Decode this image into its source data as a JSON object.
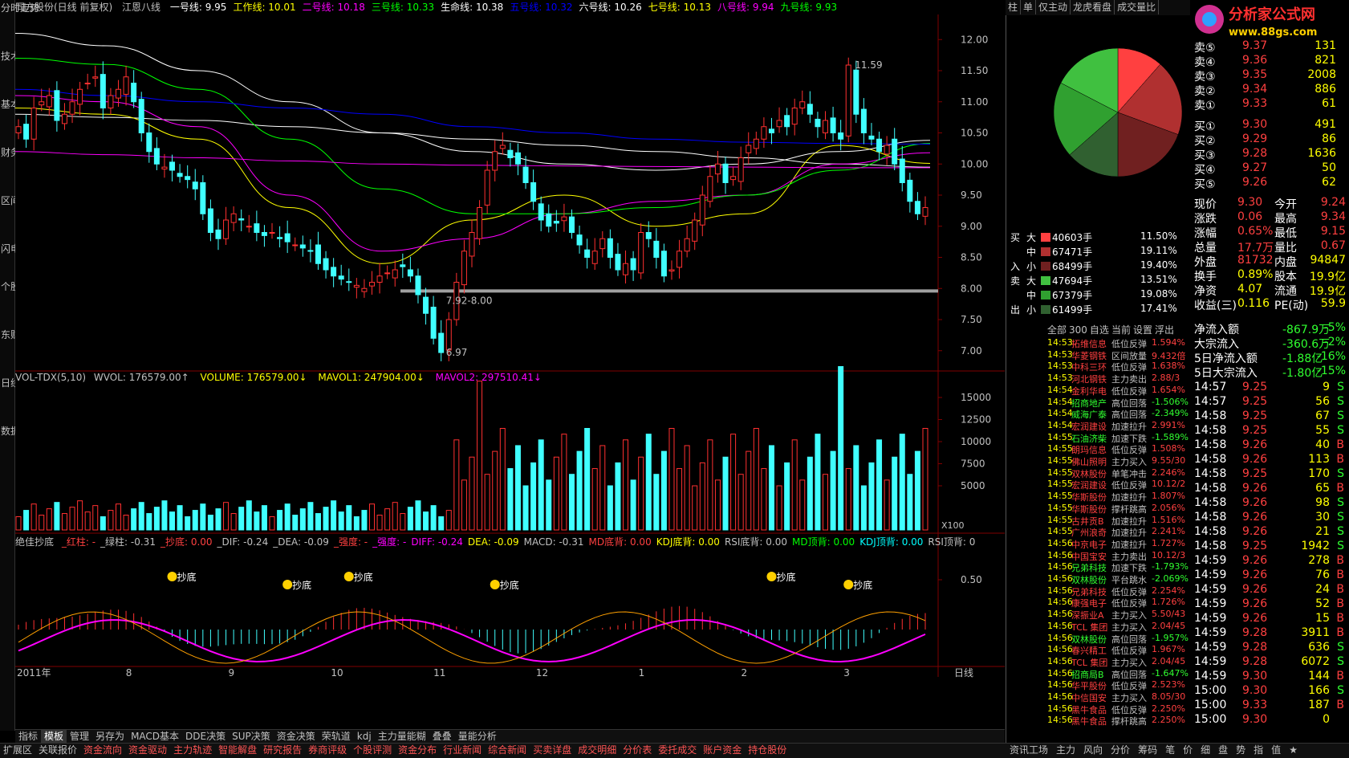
{
  "app_title": "同方股份(日线 前复权)",
  "header": {
    "indicator": "江恩八线",
    "lines": [
      {
        "label": "一号线: 9.95",
        "color": "#ffffff"
      },
      {
        "label": "工作线: 10.01",
        "color": "#ffff00"
      },
      {
        "label": "二号线: 10.18",
        "color": "#ff00ff"
      },
      {
        "label": "三号线: 10.33",
        "color": "#00ff00"
      },
      {
        "label": "生命线: 10.38",
        "color": "#ffffff"
      },
      {
        "label": "五号线: 10.32",
        "color": "#0000ff"
      },
      {
        "label": "六号线: 10.26",
        "color": "#ffffff"
      },
      {
        "label": "七号线: 10.13",
        "color": "#ffff00"
      },
      {
        "label": "八号线: 9.94",
        "color": "#ff00ff"
      },
      {
        "label": "九号线: 9.93",
        "color": "#00ff00"
      }
    ]
  },
  "left_tabs": [
    "分时走势",
    "技术分析",
    "基本资料",
    "财务透视",
    "区间排名",
    "闪电图",
    "个股透视",
    "东财深度",
    "日线报表",
    "数据下载"
  ],
  "price_axis": [
    "12.00",
    "11.50",
    "11.00",
    "10.50",
    "10.00",
    "9.50",
    "9.00",
    "8.50",
    "8.00",
    "7.50",
    "7.00"
  ],
  "annotations": {
    "high": "11.59",
    "low": "6.97",
    "range": "7.92-8.00"
  },
  "vol_title": {
    "name": "VOL-TDX(5,10)",
    "wvol": "WVOL: 176579.00↑",
    "volume": "VOLUME: 176579.00↓",
    "mavol1": "MAVOL1: 247904.00↓",
    "mavol2": "MAVOL2: 297510.41↓"
  },
  "vol_axis": [
    "15000",
    "12500",
    "10000",
    "7500",
    "5000"
  ],
  "vol_unit": "X100",
  "macd_title": {
    "name": "绝佳抄底",
    "items": [
      {
        "t": "_红柱: -",
        "c": "#ff4040"
      },
      {
        "t": "_绿柱: -0.31",
        "c": "#c0c0c0"
      },
      {
        "t": "_抄底: 0.00",
        "c": "#ff4040"
      },
      {
        "t": "_DIF: -0.24",
        "c": "#c0c0c0"
      },
      {
        "t": "_DEA: -0.09",
        "c": "#c0c0c0"
      },
      {
        "t": "_强度: -",
        "c": "#ff4040"
      },
      {
        "t": "_强度: -",
        "c": "#ff00ff"
      },
      {
        "t": "DIFF: -0.24",
        "c": "#ff00ff"
      },
      {
        "t": "DEA: -0.09",
        "c": "#ffff00"
      },
      {
        "t": "MACD: -0.31",
        "c": "#c0c0c0"
      },
      {
        "t": "MD底背: 0.00",
        "c": "#ff4040"
      },
      {
        "t": "KDJ底背: 0.00",
        "c": "#ffff00"
      },
      {
        "t": "RSI底背: 0.00",
        "c": "#c0c0c0"
      },
      {
        "t": "MD顶背: 0.00",
        "c": "#00ff00"
      },
      {
        "t": "KDJ顶背: 0.00",
        "c": "#00ffff"
      },
      {
        "t": "RSI顶背: 0",
        "c": "#c0c0c0"
      }
    ]
  },
  "macd_axis": [
    "0.50"
  ],
  "macd_label": "抄底",
  "date_axis": [
    "2011年",
    "8",
    "9",
    "10",
    "11",
    "12",
    "1",
    "2",
    "3"
  ],
  "period_label": "日线",
  "bottom_tabs1": [
    "指标",
    "模板",
    "管理",
    "另存为",
    "MACD基本",
    "DDE决策",
    "SUP决策",
    "资金决策",
    "荣轨道",
    "kdj",
    "主力量能糊",
    "叠叠",
    "量能分析"
  ],
  "bottom_tabs2": [
    "扩展区",
    "关联报价",
    "资金流向",
    "资金驱动",
    "主力轨迹",
    "智能解盘",
    "研究报告",
    "券商评级",
    "个股评测",
    "资金分布",
    "行业新闻",
    "综合新闻",
    "买卖详盘",
    "成交明细",
    "分价表",
    "委托成交",
    "账户资金",
    "持仓股份"
  ],
  "right_tabs": [
    "柱",
    "单",
    "仅主动",
    "龙虎看盘",
    "成交量比"
  ],
  "right_bottom_tabs": [
    "资讯工场",
    "主力",
    "风向",
    "分价",
    "筹码",
    "笔",
    "价",
    "细",
    "盘",
    "势",
    "指",
    "值",
    "★"
  ],
  "brand": {
    "name": "分析家公式网",
    "url": "www.88gs.com"
  },
  "pie": {
    "colors": [
      "#ff4040",
      "#b03030",
      "#702020",
      "#306030",
      "#30a030",
      "#40c040"
    ],
    "values": [
      11.5,
      19.11,
      19.4,
      13.51,
      19.08,
      17.41
    ]
  },
  "order_book": {
    "sells": [
      [
        "卖⑤",
        "9.37",
        "131"
      ],
      [
        "卖④",
        "9.36",
        "821"
      ],
      [
        "卖③",
        "9.35",
        "2008"
      ],
      [
        "卖②",
        "9.34",
        "886"
      ],
      [
        "卖①",
        "9.33",
        "61"
      ]
    ],
    "buys": [
      [
        "买①",
        "9.30",
        "491"
      ],
      [
        "买②",
        "9.29",
        "86"
      ],
      [
        "买③",
        "9.28",
        "1636"
      ],
      [
        "买④",
        "9.27",
        "50"
      ],
      [
        "买⑤",
        "9.26",
        "62"
      ]
    ]
  },
  "quote": [
    [
      "现价",
      "9.30",
      "今开",
      "9.24"
    ],
    [
      "涨跌",
      "0.06",
      "最高",
      "9.34"
    ],
    [
      "涨幅",
      "0.65%",
      "最低",
      "9.15"
    ],
    [
      "总量",
      "17.7万",
      "量比",
      "0.67"
    ],
    [
      "外盘",
      "81732",
      "内盘",
      "94847"
    ],
    [
      "换手",
      "0.89%",
      "股本",
      "19.9亿"
    ],
    [
      "净资",
      "4.07",
      "流通",
      "19.9亿"
    ],
    [
      "收益(三)",
      "0.116",
      "PE(动)",
      "59.9"
    ]
  ],
  "capital_flow": [
    [
      "净流入额",
      "-867.9万",
      "-5%"
    ],
    [
      "大宗流入",
      "-360.6万",
      "-2%"
    ],
    [
      "5日净流入额",
      "-1.88亿",
      "-16%"
    ],
    [
      "5日大宗流入",
      "-1.80亿",
      "-15%"
    ]
  ],
  "flow_side": [
    {
      "side": "买",
      "size": "大",
      "vol": "40603手",
      "pct": "11.50%",
      "color": "#ff4040"
    },
    {
      "side": "",
      "size": "中",
      "vol": "67471手",
      "pct": "19.11%",
      "color": "#b03030"
    },
    {
      "side": "入",
      "size": "小",
      "vol": "68499手",
      "pct": "19.40%",
      "color": "#702020"
    },
    {
      "side": "卖",
      "size": "大",
      "vol": "47694手",
      "pct": "13.51%",
      "color": "#40c040"
    },
    {
      "side": "",
      "size": "中",
      "vol": "67379手",
      "pct": "19.08%",
      "color": "#30a030"
    },
    {
      "side": "出",
      "size": "小",
      "vol": "61499手",
      "pct": "17.41%",
      "color": "#306030"
    }
  ],
  "news_tabs": [
    "全部",
    "300",
    "自选",
    "当前",
    "设置",
    "浮出"
  ],
  "news": [
    [
      "14:53",
      "拓维信息",
      "低位反弹",
      "1.594%"
    ],
    [
      "14:53",
      "华菱钢铁",
      "区间放量",
      "9.432倍"
    ],
    [
      "14:53",
      "中科三环",
      "低位反弹",
      "1.638%"
    ],
    [
      "14:53",
      "河北钢铁",
      "主力卖出",
      "2.88/3"
    ],
    [
      "14:54",
      "金利华电",
      "低位反弹",
      "1.654%"
    ],
    [
      "14:54",
      "招商地产",
      "高位回落",
      "-1.506%"
    ],
    [
      "14:54",
      "威海广泰",
      "高位回落",
      "-2.349%"
    ],
    [
      "14:54",
      "宏润建设",
      "加速拉升",
      "2.991%"
    ],
    [
      "14:55",
      "石油济柴",
      "加速下跌",
      "-1.589%"
    ],
    [
      "14:55",
      "朗玛信息",
      "低位反弹",
      "1.508%"
    ],
    [
      "14:55",
      "佛山照明",
      "主力买入",
      "9.55/30"
    ],
    [
      "14:55",
      "双林股份",
      "单笔冲击",
      "2.246%"
    ],
    [
      "14:55",
      "宏润建设",
      "低位反弹",
      "10.12/2"
    ],
    [
      "14:55",
      "华斯股份",
      "加速拉升",
      "1.807%"
    ],
    [
      "14:55",
      "华斯股份",
      "撑杆跳高",
      "2.056%"
    ],
    [
      "14:55",
      "古井贡B",
      "加速拉升",
      "1.516%"
    ],
    [
      "14:55",
      "广州浪奇",
      "加速拉升",
      "2.241%"
    ],
    [
      "14:56",
      "中京电子",
      "加速拉升",
      "1.727%"
    ],
    [
      "14:56",
      "中国宝安",
      "主力卖出",
      "10.12/3"
    ],
    [
      "14:56",
      "兄弟科技",
      "加速下跌",
      "-1.793%"
    ],
    [
      "14:56",
      "双林股份",
      "平台跳水",
      "-2.069%"
    ],
    [
      "14:56",
      "兄弟科技",
      "低位反弹",
      "2.254%"
    ],
    [
      "14:56",
      "康强电子",
      "低位反弹",
      "1.726%"
    ],
    [
      "14:56",
      "深振业A",
      "主力买入",
      "5.50/43"
    ],
    [
      "14:56",
      "TCL 集团",
      "主力买入",
      "2.04/45"
    ],
    [
      "14:56",
      "双林股份",
      "高位回落",
      "-1.957%"
    ],
    [
      "14:56",
      "春兴精工",
      "低位反弹",
      "1.967%"
    ],
    [
      "14:56",
      "TCL 集团",
      "主力买入",
      "2.04/45"
    ],
    [
      "14:56",
      "招商局B",
      "高位回落",
      "-1.647%"
    ],
    [
      "14:56",
      "华平股份",
      "低位反弹",
      "2.523%"
    ],
    [
      "14:56",
      "中信国安",
      "主力买入",
      "8.05/30"
    ],
    [
      "14:56",
      "黑牛食品",
      "低位反弹",
      "2.250%"
    ],
    [
      "14:56",
      "黑牛食品",
      "撑杆跳高",
      "2.250%"
    ],
    [
      "14:56",
      "黑牛食品",
      "主力买入",
      "2.188%"
    ]
  ],
  "ticks": [
    [
      "14:57",
      "9.25",
      "9",
      "S"
    ],
    [
      "14:57",
      "9.25",
      "56",
      "S"
    ],
    [
      "14:58",
      "9.25",
      "67",
      "S"
    ],
    [
      "14:58",
      "9.25",
      "55",
      "S"
    ],
    [
      "14:58",
      "9.26",
      "40",
      "B"
    ],
    [
      "14:58",
      "9.26",
      "113",
      "B"
    ],
    [
      "14:58",
      "9.25",
      "170",
      "S"
    ],
    [
      "14:58",
      "9.26",
      "65",
      "B"
    ],
    [
      "14:58",
      "9.26",
      "98",
      "S"
    ],
    [
      "14:58",
      "9.26",
      "30",
      "S"
    ],
    [
      "14:58",
      "9.26",
      "21",
      "S"
    ],
    [
      "14:58",
      "9.25",
      "1942",
      "S"
    ],
    [
      "14:59",
      "9.26",
      "278",
      "B"
    ],
    [
      "14:59",
      "9.26",
      "76",
      "B"
    ],
    [
      "14:59",
      "9.26",
      "24",
      "B"
    ],
    [
      "14:59",
      "9.26",
      "52",
      "B"
    ],
    [
      "14:59",
      "9.26",
      "15",
      "B"
    ],
    [
      "14:59",
      "9.28",
      "3911",
      "B"
    ],
    [
      "14:59",
      "9.28",
      "636",
      "S"
    ],
    [
      "14:59",
      "9.28",
      "6072",
      "S"
    ],
    [
      "14:59",
      "9.30",
      "144",
      "B"
    ],
    [
      "15:00",
      "9.30",
      "166",
      "S"
    ],
    [
      "15:00",
      "9.33",
      "187",
      "B"
    ],
    [
      "15:00",
      "9.30",
      "0",
      ""
    ]
  ],
  "chart_data": {
    "type": "candlestick",
    "title": "同方股份(日线 前复权)",
    "ylim": [
      6.7,
      12.3
    ],
    "y_ticks": [
      7.0,
      7.5,
      8.0,
      8.5,
      9.0,
      9.5,
      10.0,
      10.5,
      11.0,
      11.5,
      12.0
    ],
    "x_ticks": [
      "2011年",
      "8",
      "9",
      "10",
      "11",
      "12",
      "1",
      "2",
      "3"
    ],
    "close": [
      10.6,
      10.4,
      10.9,
      11.0,
      11.1,
      10.7,
      10.8,
      11.0,
      11.2,
      11.3,
      11.4,
      10.9,
      11.1,
      11.2,
      11.4,
      11.0,
      10.5,
      10.2,
      10.0,
      9.95,
      9.9,
      9.8,
      9.75,
      9.6,
      9.2,
      8.9,
      8.8,
      9.1,
      9.2,
      9.1,
      9.0,
      8.9,
      8.85,
      8.9,
      8.8,
      8.75,
      8.7,
      8.65,
      8.6,
      8.4,
      8.3,
      8.2,
      8.15,
      8.1,
      8.05,
      8.0,
      8.1,
      8.2,
      8.25,
      8.3,
      8.35,
      8.2,
      7.9,
      7.6,
      7.2,
      6.97,
      7.5,
      8.1,
      8.6,
      8.9,
      9.3,
      9.9,
      10.2,
      10.3,
      10.1,
      10.0,
      9.7,
      9.4,
      9.1,
      9.0,
      9.05,
      9.15,
      8.9,
      8.7,
      8.5,
      8.6,
      8.8,
      8.5,
      8.3,
      8.4,
      8.3,
      8.9,
      8.8,
      8.5,
      8.2,
      8.3,
      8.6,
      8.8,
      9.1,
      9.5,
      9.8,
      10.0,
      9.7,
      9.8,
      10.1,
      10.3,
      10.4,
      10.6,
      10.5,
      10.7,
      10.6,
      10.9,
      11.0,
      10.8,
      10.6,
      10.7,
      10.5,
      10.4,
      11.59,
      10.8,
      10.5,
      10.4,
      10.2,
      10.3,
      10.0,
      9.7,
      9.4,
      9.2,
      9.3
    ],
    "ma": [
      {
        "name": "一号线",
        "color": "#ffffff",
        "values": [
          10.8,
          10.75,
          10.7,
          10.6,
          10.5,
          10.4,
          10.3,
          10.2,
          10.1,
          10.0,
          9.95
        ]
      },
      {
        "name": "工作线",
        "color": "#ffff00",
        "values": [
          10.9,
          10.8,
          10.4,
          9.3,
          8.4,
          9.1,
          9.5,
          9.0,
          9.2,
          10.3,
          10.01
        ]
      },
      {
        "name": "二号线",
        "color": "#ff00ff",
        "values": [
          11.1,
          11.0,
          10.6,
          9.5,
          8.6,
          8.8,
          9.2,
          9.4,
          9.5,
          10.0,
          10.18
        ]
      },
      {
        "name": "三号线",
        "color": "#00ff00",
        "values": [
          11.7,
          11.6,
          11.2,
          10.4,
          9.6,
          9.2,
          9.2,
          9.3,
          9.5,
          9.9,
          10.33
        ]
      },
      {
        "name": "生命线",
        "color": "#ffffff",
        "values": [
          12.1,
          11.9,
          11.5,
          11.0,
          10.5,
          10.2,
          10.0,
          9.9,
          10.0,
          10.2,
          10.38
        ]
      },
      {
        "name": "五号线",
        "color": "#0000ff",
        "values": [
          11.2,
          11.1,
          11.0,
          10.9,
          10.8,
          10.6,
          10.5,
          10.4,
          10.35,
          10.33,
          10.32
        ]
      },
      {
        "name": "八号线",
        "color": "#ff00ff",
        "values": [
          10.2,
          10.15,
          10.1,
          10.05,
          10.0,
          9.98,
          9.97,
          9.96,
          9.95,
          9.94,
          9.94
        ]
      }
    ],
    "volume_series": {
      "name": "VOL-TDX(5,10)",
      "ylim": [
        0,
        16000
      ]
    },
    "macd_series": {
      "name": "绝佳抄底",
      "dif_last": -0.24,
      "dea_last": -0.09,
      "macd_last": -0.31
    }
  }
}
